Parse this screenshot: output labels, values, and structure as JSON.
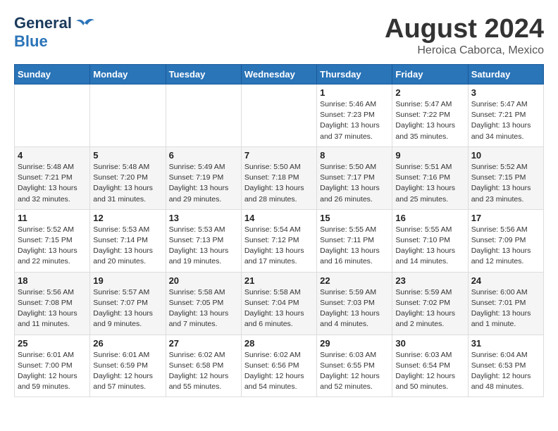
{
  "header": {
    "logo_general": "General",
    "logo_blue": "Blue",
    "month": "August 2024",
    "location": "Heroica Caborca, Mexico"
  },
  "days_of_week": [
    "Sunday",
    "Monday",
    "Tuesday",
    "Wednesday",
    "Thursday",
    "Friday",
    "Saturday"
  ],
  "weeks": [
    [
      {
        "day": "",
        "info": ""
      },
      {
        "day": "",
        "info": ""
      },
      {
        "day": "",
        "info": ""
      },
      {
        "day": "",
        "info": ""
      },
      {
        "day": "1",
        "info": "Sunrise: 5:46 AM\nSunset: 7:23 PM\nDaylight: 13 hours\nand 37 minutes."
      },
      {
        "day": "2",
        "info": "Sunrise: 5:47 AM\nSunset: 7:22 PM\nDaylight: 13 hours\nand 35 minutes."
      },
      {
        "day": "3",
        "info": "Sunrise: 5:47 AM\nSunset: 7:21 PM\nDaylight: 13 hours\nand 34 minutes."
      }
    ],
    [
      {
        "day": "4",
        "info": "Sunrise: 5:48 AM\nSunset: 7:21 PM\nDaylight: 13 hours\nand 32 minutes."
      },
      {
        "day": "5",
        "info": "Sunrise: 5:48 AM\nSunset: 7:20 PM\nDaylight: 13 hours\nand 31 minutes."
      },
      {
        "day": "6",
        "info": "Sunrise: 5:49 AM\nSunset: 7:19 PM\nDaylight: 13 hours\nand 29 minutes."
      },
      {
        "day": "7",
        "info": "Sunrise: 5:50 AM\nSunset: 7:18 PM\nDaylight: 13 hours\nand 28 minutes."
      },
      {
        "day": "8",
        "info": "Sunrise: 5:50 AM\nSunset: 7:17 PM\nDaylight: 13 hours\nand 26 minutes."
      },
      {
        "day": "9",
        "info": "Sunrise: 5:51 AM\nSunset: 7:16 PM\nDaylight: 13 hours\nand 25 minutes."
      },
      {
        "day": "10",
        "info": "Sunrise: 5:52 AM\nSunset: 7:15 PM\nDaylight: 13 hours\nand 23 minutes."
      }
    ],
    [
      {
        "day": "11",
        "info": "Sunrise: 5:52 AM\nSunset: 7:15 PM\nDaylight: 13 hours\nand 22 minutes."
      },
      {
        "day": "12",
        "info": "Sunrise: 5:53 AM\nSunset: 7:14 PM\nDaylight: 13 hours\nand 20 minutes."
      },
      {
        "day": "13",
        "info": "Sunrise: 5:53 AM\nSunset: 7:13 PM\nDaylight: 13 hours\nand 19 minutes."
      },
      {
        "day": "14",
        "info": "Sunrise: 5:54 AM\nSunset: 7:12 PM\nDaylight: 13 hours\nand 17 minutes."
      },
      {
        "day": "15",
        "info": "Sunrise: 5:55 AM\nSunset: 7:11 PM\nDaylight: 13 hours\nand 16 minutes."
      },
      {
        "day": "16",
        "info": "Sunrise: 5:55 AM\nSunset: 7:10 PM\nDaylight: 13 hours\nand 14 minutes."
      },
      {
        "day": "17",
        "info": "Sunrise: 5:56 AM\nSunset: 7:09 PM\nDaylight: 13 hours\nand 12 minutes."
      }
    ],
    [
      {
        "day": "18",
        "info": "Sunrise: 5:56 AM\nSunset: 7:08 PM\nDaylight: 13 hours\nand 11 minutes."
      },
      {
        "day": "19",
        "info": "Sunrise: 5:57 AM\nSunset: 7:07 PM\nDaylight: 13 hours\nand 9 minutes."
      },
      {
        "day": "20",
        "info": "Sunrise: 5:58 AM\nSunset: 7:05 PM\nDaylight: 13 hours\nand 7 minutes."
      },
      {
        "day": "21",
        "info": "Sunrise: 5:58 AM\nSunset: 7:04 PM\nDaylight: 13 hours\nand 6 minutes."
      },
      {
        "day": "22",
        "info": "Sunrise: 5:59 AM\nSunset: 7:03 PM\nDaylight: 13 hours\nand 4 minutes."
      },
      {
        "day": "23",
        "info": "Sunrise: 5:59 AM\nSunset: 7:02 PM\nDaylight: 13 hours\nand 2 minutes."
      },
      {
        "day": "24",
        "info": "Sunrise: 6:00 AM\nSunset: 7:01 PM\nDaylight: 13 hours\nand 1 minute."
      }
    ],
    [
      {
        "day": "25",
        "info": "Sunrise: 6:01 AM\nSunset: 7:00 PM\nDaylight: 12 hours\nand 59 minutes."
      },
      {
        "day": "26",
        "info": "Sunrise: 6:01 AM\nSunset: 6:59 PM\nDaylight: 12 hours\nand 57 minutes."
      },
      {
        "day": "27",
        "info": "Sunrise: 6:02 AM\nSunset: 6:58 PM\nDaylight: 12 hours\nand 55 minutes."
      },
      {
        "day": "28",
        "info": "Sunrise: 6:02 AM\nSunset: 6:56 PM\nDaylight: 12 hours\nand 54 minutes."
      },
      {
        "day": "29",
        "info": "Sunrise: 6:03 AM\nSunset: 6:55 PM\nDaylight: 12 hours\nand 52 minutes."
      },
      {
        "day": "30",
        "info": "Sunrise: 6:03 AM\nSunset: 6:54 PM\nDaylight: 12 hours\nand 50 minutes."
      },
      {
        "day": "31",
        "info": "Sunrise: 6:04 AM\nSunset: 6:53 PM\nDaylight: 12 hours\nand 48 minutes."
      }
    ]
  ]
}
